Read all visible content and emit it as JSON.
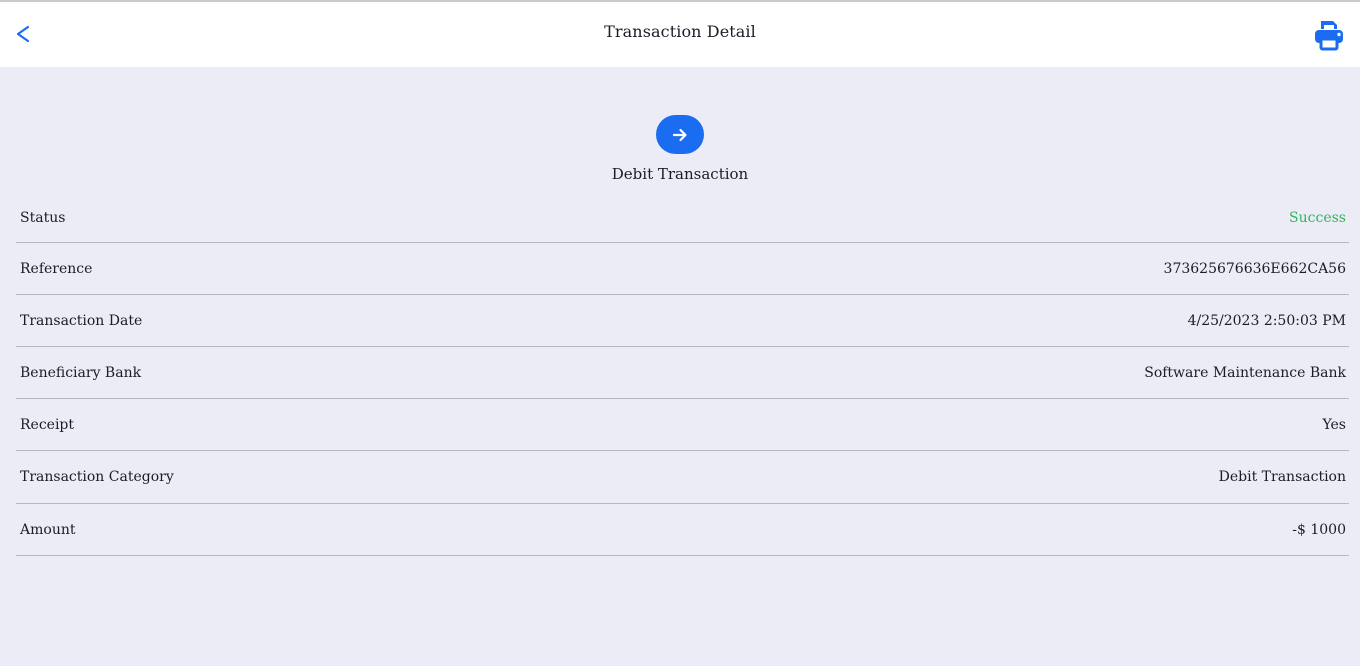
{
  "header": {
    "title": "Transaction Detail",
    "back_icon": "chevron-left-icon",
    "print_icon": "printer-icon"
  },
  "summary": {
    "icon": "arrow-right-icon",
    "type": "Debit Transaction"
  },
  "details": [
    {
      "label": "Status",
      "value": "Success"
    },
    {
      "label": "Reference",
      "value": "373625676636E662CA56"
    },
    {
      "label": "Transaction Date",
      "value": "4/25/2023 2:50:03 PM"
    },
    {
      "label": "Beneficiary Bank",
      "value": "Software Maintenance Bank"
    },
    {
      "label": "Receipt",
      "value": "Yes"
    },
    {
      "label": "Transaction Category",
      "value": "Debit Transaction"
    },
    {
      "label": "Amount",
      "value": "-$ 1000"
    }
  ],
  "colors": {
    "accent": "#1a6cf0",
    "success": "#2fb65c",
    "background": "#ebecf5",
    "header_bg": "#ffffff",
    "divider": "#b8b8c0"
  }
}
